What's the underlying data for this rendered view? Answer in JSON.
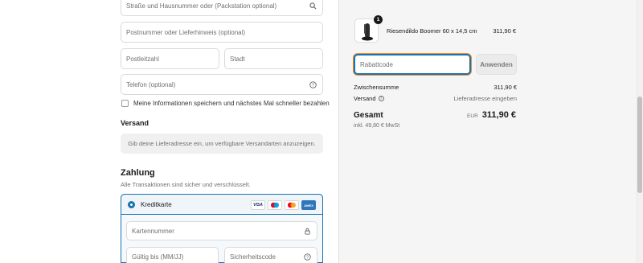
{
  "address": {
    "street_placeholder": "Straße und Hausnummer oder (Packstation optional)",
    "postal_note_placeholder": "Postnummer oder Lieferhinweis (optional)",
    "zip_placeholder": "Postleitzahl",
    "city_placeholder": "Stadt",
    "phone_placeholder": "Telefon (optional)"
  },
  "save_info_label": "Meine Informationen speichern und nächstes Mal schneller bezahlen",
  "shipping": {
    "title": "Versand",
    "notice": "Gib deine Lieferadresse ein, um verfügbare Versandarten anzuzeigen."
  },
  "payment": {
    "title": "Zahlung",
    "subtitle": "Alle Transaktionen sind sicher und verschlüsselt.",
    "method_label": "Kreditkarte",
    "brands": [
      "VISA",
      "Maestro",
      "Mastercard",
      "AMEX"
    ],
    "card_number_placeholder": "Kartennummer",
    "expiry_placeholder": "Gültig bis (MM/JJ)",
    "cvc_placeholder": "Sicherheitscode"
  },
  "order": {
    "product_name": "Riesendildo Boomer 60 x 14,5 cm",
    "product_price": "311,90 €",
    "quantity": "1",
    "discount_placeholder": "Rabattcode",
    "apply_label": "Anwenden",
    "subtotal_label": "Zwischensumme",
    "subtotal_value": "311,90 €",
    "shipping_label": "Versand",
    "shipping_value": "Lieferadresse eingeben",
    "total_label": "Gesamt",
    "currency": "EUR",
    "total_value": "311,90 €",
    "tax_note": "inkl. 49,80 € MwSt"
  },
  "colors": {
    "accent": "#1773b0",
    "focus_outline": "#f08c2a",
    "summary_bg": "#f5f5f5"
  }
}
